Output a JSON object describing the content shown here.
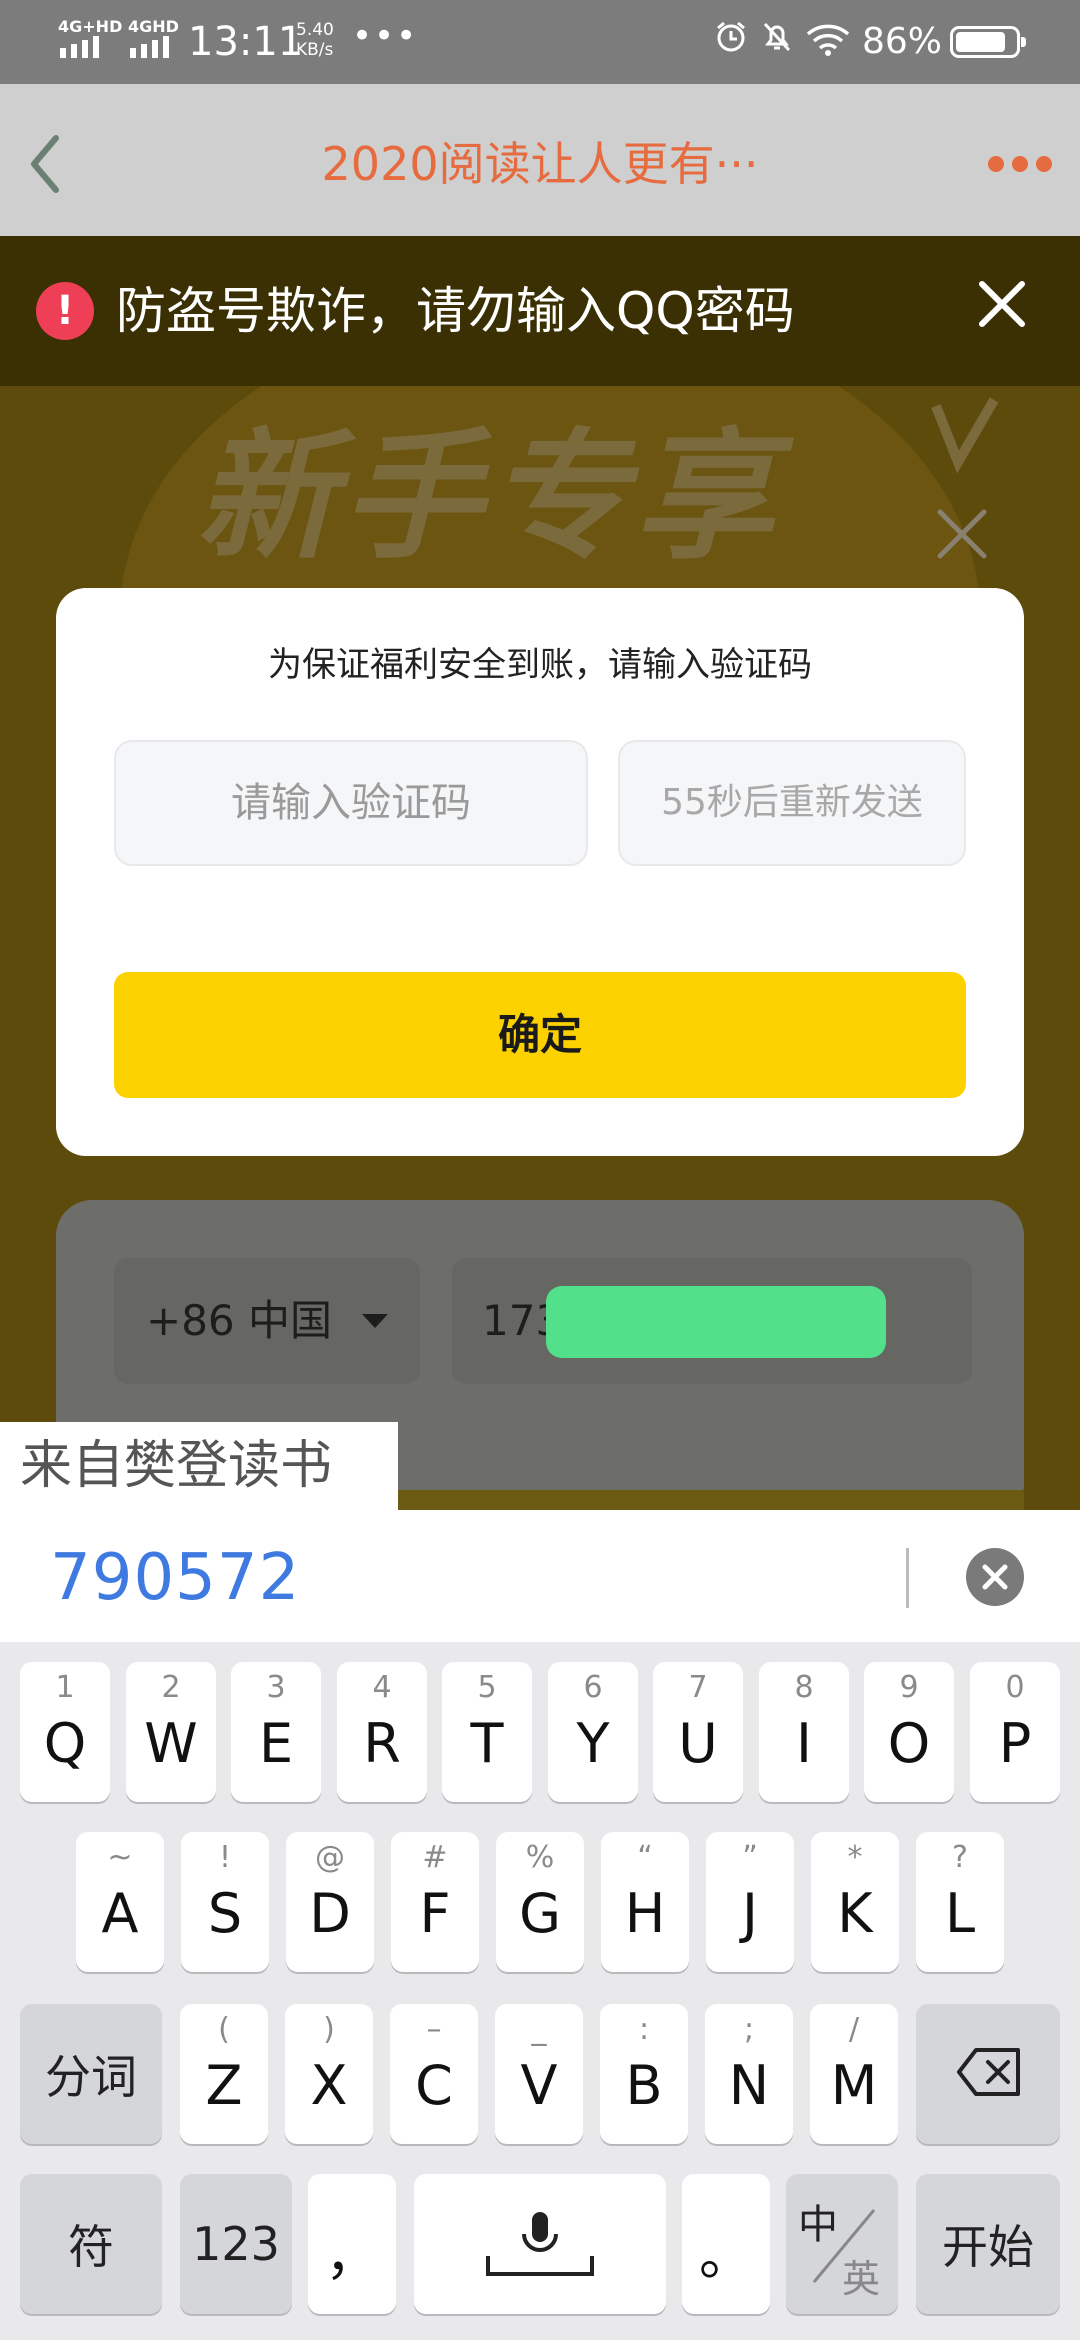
{
  "status_bar": {
    "network_1": "4G+HD",
    "network_2": "4GHD",
    "time": "13:11",
    "speed_value": "5.40",
    "speed_unit": "KB/s",
    "more": "•••",
    "battery": "86%",
    "battery_level": 0.86
  },
  "title_bar": {
    "title": "2020阅读让人更有···"
  },
  "warning": {
    "icon": "!",
    "text": "防盗号欺诈，请勿输入QQ密码"
  },
  "promo": {
    "heading": "新手专享"
  },
  "dialog": {
    "prompt": "为保证福利安全到账，请输入验证码",
    "code_placeholder": "请输入验证码",
    "resend": "55秒后重新发送",
    "confirm": "确定"
  },
  "login": {
    "country": "+86 中国",
    "phone_prefix": "173"
  },
  "sms_suggestion": {
    "source": "来自樊登读书",
    "code": "790572"
  },
  "keyboard": {
    "row1": [
      {
        "main": "Q",
        "sub": "1"
      },
      {
        "main": "W",
        "sub": "2"
      },
      {
        "main": "E",
        "sub": "3"
      },
      {
        "main": "R",
        "sub": "4"
      },
      {
        "main": "T",
        "sub": "5"
      },
      {
        "main": "Y",
        "sub": "6"
      },
      {
        "main": "U",
        "sub": "7"
      },
      {
        "main": "I",
        "sub": "8"
      },
      {
        "main": "O",
        "sub": "9"
      },
      {
        "main": "P",
        "sub": "0"
      }
    ],
    "row2": [
      {
        "main": "A",
        "sub": "~"
      },
      {
        "main": "S",
        "sub": "!"
      },
      {
        "main": "D",
        "sub": "@"
      },
      {
        "main": "F",
        "sub": "#"
      },
      {
        "main": "G",
        "sub": "%"
      },
      {
        "main": "H",
        "sub": "“"
      },
      {
        "main": "J",
        "sub": "”"
      },
      {
        "main": "K",
        "sub": "*"
      },
      {
        "main": "L",
        "sub": "?"
      }
    ],
    "row3": [
      {
        "main": "Z",
        "sub": "("
      },
      {
        "main": "X",
        "sub": ")"
      },
      {
        "main": "C",
        "sub": "–"
      },
      {
        "main": "V",
        "sub": "_"
      },
      {
        "main": "B",
        "sub": ":"
      },
      {
        "main": "N",
        "sub": ";"
      },
      {
        "main": "M",
        "sub": "/"
      }
    ],
    "segment": "分词",
    "symbols": "符",
    "numbers": "123",
    "comma": "，",
    "period": "。",
    "lang_zh": "中",
    "lang_en": "英",
    "start": "开始"
  }
}
